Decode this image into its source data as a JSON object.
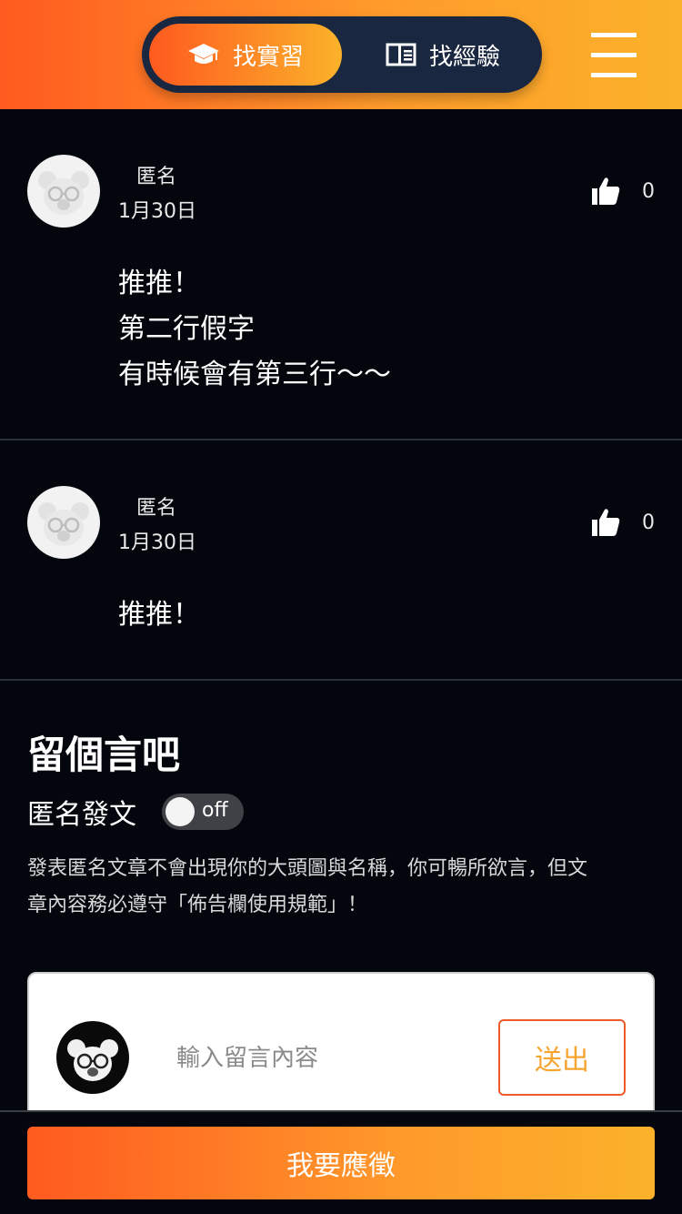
{
  "header": {
    "tabs": [
      {
        "label": "找實習",
        "icon": "graduation-cap-icon",
        "active": true
      },
      {
        "label": "找經驗",
        "icon": "book-icon",
        "active": false
      }
    ],
    "menu_icon": "hamburger-menu-icon"
  },
  "comments": [
    {
      "author": "匿名",
      "date": "1月30日",
      "likes": "0",
      "lines": [
        "推推！",
        "第二行假字",
        "有時候會有第三行～～"
      ]
    },
    {
      "author": "匿名",
      "date": "1月30日",
      "likes": "0",
      "lines": [
        "推推！"
      ]
    }
  ],
  "compose": {
    "title": "留個言吧",
    "anon_label": "匿名發文",
    "toggle_state": "off",
    "notice_lines": [
      "發表匿名文章不會出現你的大頭圖與名稱，你可暢所欲言，但文",
      "章內容務必遵守「佈告欄使用規範」！"
    ],
    "input_placeholder": "輸入留言內容",
    "send_label": "送出"
  },
  "bottom": {
    "apply_label": "我要應徵"
  },
  "colors": {
    "accent_start": "#ff5a1f",
    "accent_end": "#fbb22a",
    "background": "#03060d",
    "segment_bg": "#1a2740"
  }
}
